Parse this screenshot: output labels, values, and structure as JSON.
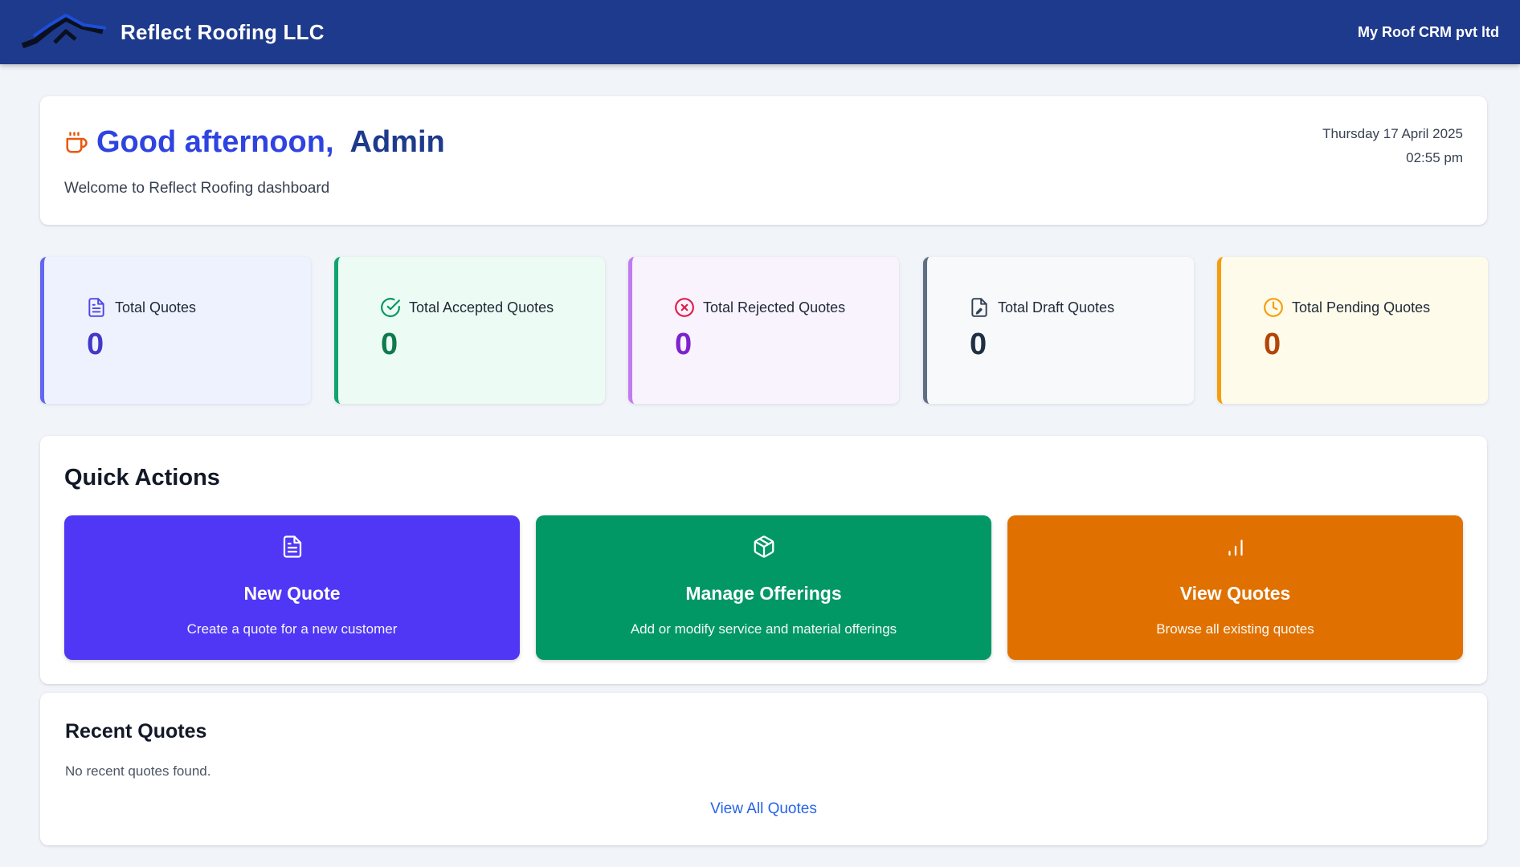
{
  "header": {
    "brand_name": "Reflect Roofing LLC",
    "company": "My Roof CRM pvt ltd",
    "logo_icon": "roof-logo"
  },
  "greeting": {
    "icon": "coffee-cup-icon",
    "title": "Good afternoon,",
    "name": "Admin",
    "welcome": "Welcome to Reflect Roofing dashboard",
    "date": "Thursday 17 April 2025",
    "time": "02:55 pm"
  },
  "stats": [
    {
      "label": "Total Quotes",
      "value": "0",
      "icon": "document-icon",
      "color": "#4338ca"
    },
    {
      "label": "Total Accepted Quotes",
      "value": "0",
      "icon": "check-circle-icon",
      "color": "#0f7a4d"
    },
    {
      "label": "Total Rejected Quotes",
      "value": "0",
      "icon": "x-circle-icon",
      "color": "#7e22ce"
    },
    {
      "label": "Total Draft Quotes",
      "value": "0",
      "icon": "file-edit-icon",
      "color": "#1f2f45"
    },
    {
      "label": "Total Pending Quotes",
      "value": "0",
      "icon": "clock-icon",
      "color": "#b4450a"
    }
  ],
  "quick_actions": {
    "title": "Quick Actions",
    "items": [
      {
        "title": "New Quote",
        "desc": "Create a quote for a new customer",
        "icon": "document-icon",
        "color": "#4f37f5"
      },
      {
        "title": "Manage Offerings",
        "desc": "Add or modify service and material offerings",
        "icon": "package-icon",
        "color": "#029866"
      },
      {
        "title": "View Quotes",
        "desc": "Browse all existing quotes",
        "icon": "bar-chart-icon",
        "color": "#e07100"
      }
    ]
  },
  "recent": {
    "title": "Recent Quotes",
    "empty_text": "No recent quotes found.",
    "link_label": "View All Quotes"
  }
}
